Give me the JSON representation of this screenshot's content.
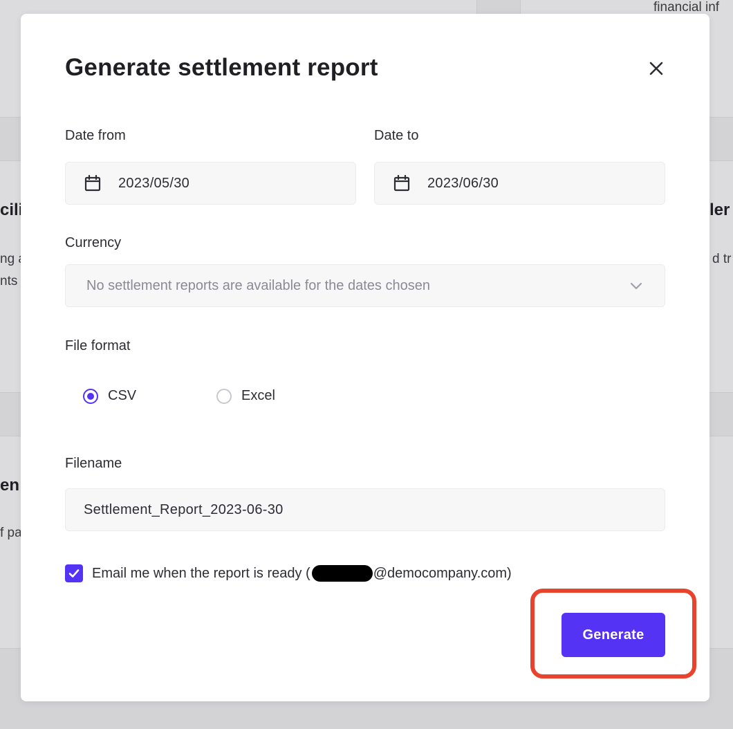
{
  "background": {
    "text_top_right": "financial inf",
    "text_left_1": "cili",
    "text_left_2": "ng a",
    "text_left_3": "nts",
    "text_left_4": "en",
    "text_left_5": "f pa",
    "text_right_1": "ler",
    "text_right_2": "d tr"
  },
  "modal": {
    "title": "Generate settlement report",
    "close_icon": "close-icon",
    "date_from": {
      "label": "Date from",
      "value": "2023/05/30",
      "icon": "calendar-icon"
    },
    "date_to": {
      "label": "Date to",
      "value": "2023/06/30",
      "icon": "calendar-icon"
    },
    "currency": {
      "label": "Currency",
      "placeholder": "No settlement reports are available for the dates chosen",
      "icon": "chevron-down-icon"
    },
    "file_format": {
      "label": "File format",
      "options": [
        {
          "label": "CSV",
          "checked": true
        },
        {
          "label": "Excel",
          "checked": false
        }
      ]
    },
    "filename": {
      "label": "Filename",
      "value": "Settlement_Report_2023-06-30"
    },
    "email": {
      "checked": true,
      "label_prefix": "Email me when the report is ready (",
      "label_suffix": "@democompany.com)"
    },
    "generate_label": "Generate"
  },
  "colors": {
    "accent": "#5433f5",
    "highlight": "#e8432c"
  }
}
